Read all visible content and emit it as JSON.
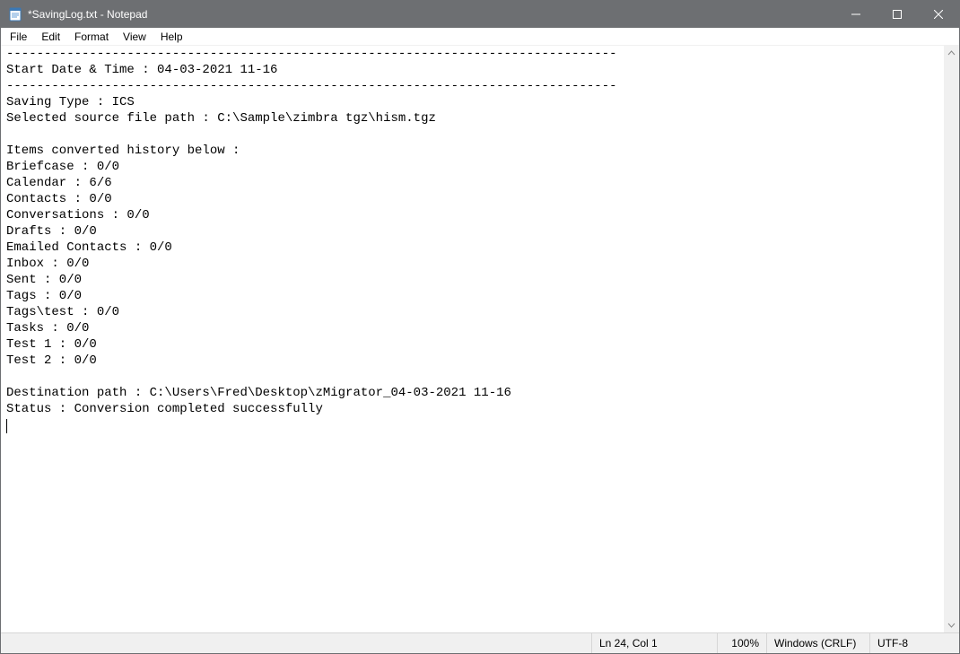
{
  "window": {
    "title": "*SavingLog.txt - Notepad"
  },
  "menu": {
    "file": "File",
    "edit": "Edit",
    "format": "Format",
    "view": "View",
    "help": "Help"
  },
  "document": {
    "sep": "---------------------------------------------------------------------------------",
    "start_label": "Start Date & Time : ",
    "start_value": "04-03-2021 11-16",
    "saving_type_label": "Saving Type : ",
    "saving_type_value": "ICS",
    "source_path_label": "Selected source file path : ",
    "source_path_value": "C:\\Sample\\zimbra tgz\\hism.tgz",
    "history_header": "Items converted history below :",
    "items": [
      {
        "name": "Briefcase",
        "counts": "0/0"
      },
      {
        "name": "Calendar",
        "counts": "6/6"
      },
      {
        "name": "Contacts",
        "counts": "0/0"
      },
      {
        "name": "Conversations",
        "counts": "0/0"
      },
      {
        "name": "Drafts",
        "counts": "0/0"
      },
      {
        "name": "Emailed Contacts",
        "counts": "0/0"
      },
      {
        "name": "Inbox",
        "counts": "0/0"
      },
      {
        "name": "Sent",
        "counts": "0/0"
      },
      {
        "name": "Tags",
        "counts": "0/0"
      },
      {
        "name": "Tags\\test",
        "counts": "0/0"
      },
      {
        "name": "Tasks",
        "counts": "0/0"
      },
      {
        "name": "Test 1",
        "counts": "0/0"
      },
      {
        "name": "Test 2",
        "counts": "0/0"
      }
    ],
    "dest_path_label": "Destination path : ",
    "dest_path_value": "C:\\Users\\Fred\\Desktop\\zMigrator_04-03-2021 11-16",
    "status_label": "Status : ",
    "status_value": "Conversion completed successfully"
  },
  "status": {
    "lncol": "Ln 24, Col 1",
    "zoom": "100%",
    "line_ending": "Windows (CRLF)",
    "encoding": "UTF-8"
  }
}
